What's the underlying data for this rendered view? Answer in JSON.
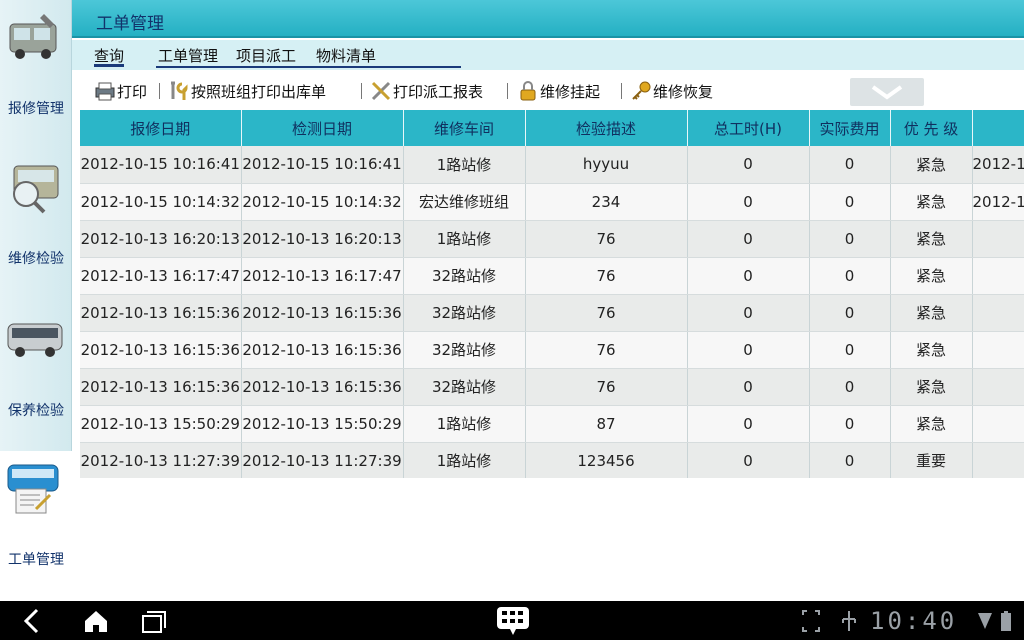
{
  "sidebar": {
    "items": [
      {
        "label": "报修管理",
        "icon": "repair-truck-icon"
      },
      {
        "label": "维修检验",
        "icon": "inspection-bus-icon"
      },
      {
        "label": "保养检验",
        "icon": "maintenance-bus-icon"
      },
      {
        "label": "工单管理",
        "icon": "work-order-bus-icon",
        "active": true
      }
    ]
  },
  "header": {
    "title": "工单管理"
  },
  "tabs": [
    {
      "label": "查询",
      "active": true
    },
    {
      "label": "工单管理"
    },
    {
      "label": "项目派工"
    },
    {
      "label": "物料清单"
    }
  ],
  "toolbar": {
    "print": "打印",
    "print_by_team": "按照班组打印出库单",
    "print_dispatch": "打印派工报表",
    "repair_hold": "维修挂起",
    "repair_resume": "维修恢复"
  },
  "table": {
    "columns": [
      "报修日期",
      "检测日期",
      "维修车间",
      "检验描述",
      "总工时(H)",
      "实际费用",
      "优 先 级",
      ""
    ],
    "rows": [
      [
        "2012-10-15 10:16:41",
        "2012-10-15 10:16:41",
        "1路站修",
        "hyyuu",
        "0",
        "0",
        "紧急",
        "2012-1"
      ],
      [
        "2012-10-15 10:14:32",
        "2012-10-15 10:14:32",
        "宏达维修班组",
        "234",
        "0",
        "0",
        "紧急",
        "2012-1"
      ],
      [
        "2012-10-13 16:20:13",
        "2012-10-13 16:20:13",
        "1路站修",
        "76",
        "0",
        "0",
        "紧急",
        ""
      ],
      [
        "2012-10-13 16:17:47",
        "2012-10-13 16:17:47",
        "32路站修",
        "76",
        "0",
        "0",
        "紧急",
        ""
      ],
      [
        "2012-10-13 16:15:36",
        "2012-10-13 16:15:36",
        "32路站修",
        "76",
        "0",
        "0",
        "紧急",
        ""
      ],
      [
        "2012-10-13 16:15:36",
        "2012-10-13 16:15:36",
        "32路站修",
        "76",
        "0",
        "0",
        "紧急",
        ""
      ],
      [
        "2012-10-13 16:15:36",
        "2012-10-13 16:15:36",
        "32路站修",
        "76",
        "0",
        "0",
        "紧急",
        ""
      ],
      [
        "2012-10-13 15:50:29",
        "2012-10-13 15:50:29",
        "1路站修",
        "87",
        "0",
        "0",
        "紧急",
        ""
      ],
      [
        "2012-10-13 11:27:39",
        "2012-10-13 11:27:39",
        "1路站修",
        "123456",
        "0",
        "0",
        "重要",
        ""
      ]
    ]
  },
  "statusbar": {
    "time": "10:40"
  },
  "colors": {
    "header": "#2bb6c8",
    "nav_text": "#12336b",
    "tab_bg": "#d6f0f4"
  }
}
